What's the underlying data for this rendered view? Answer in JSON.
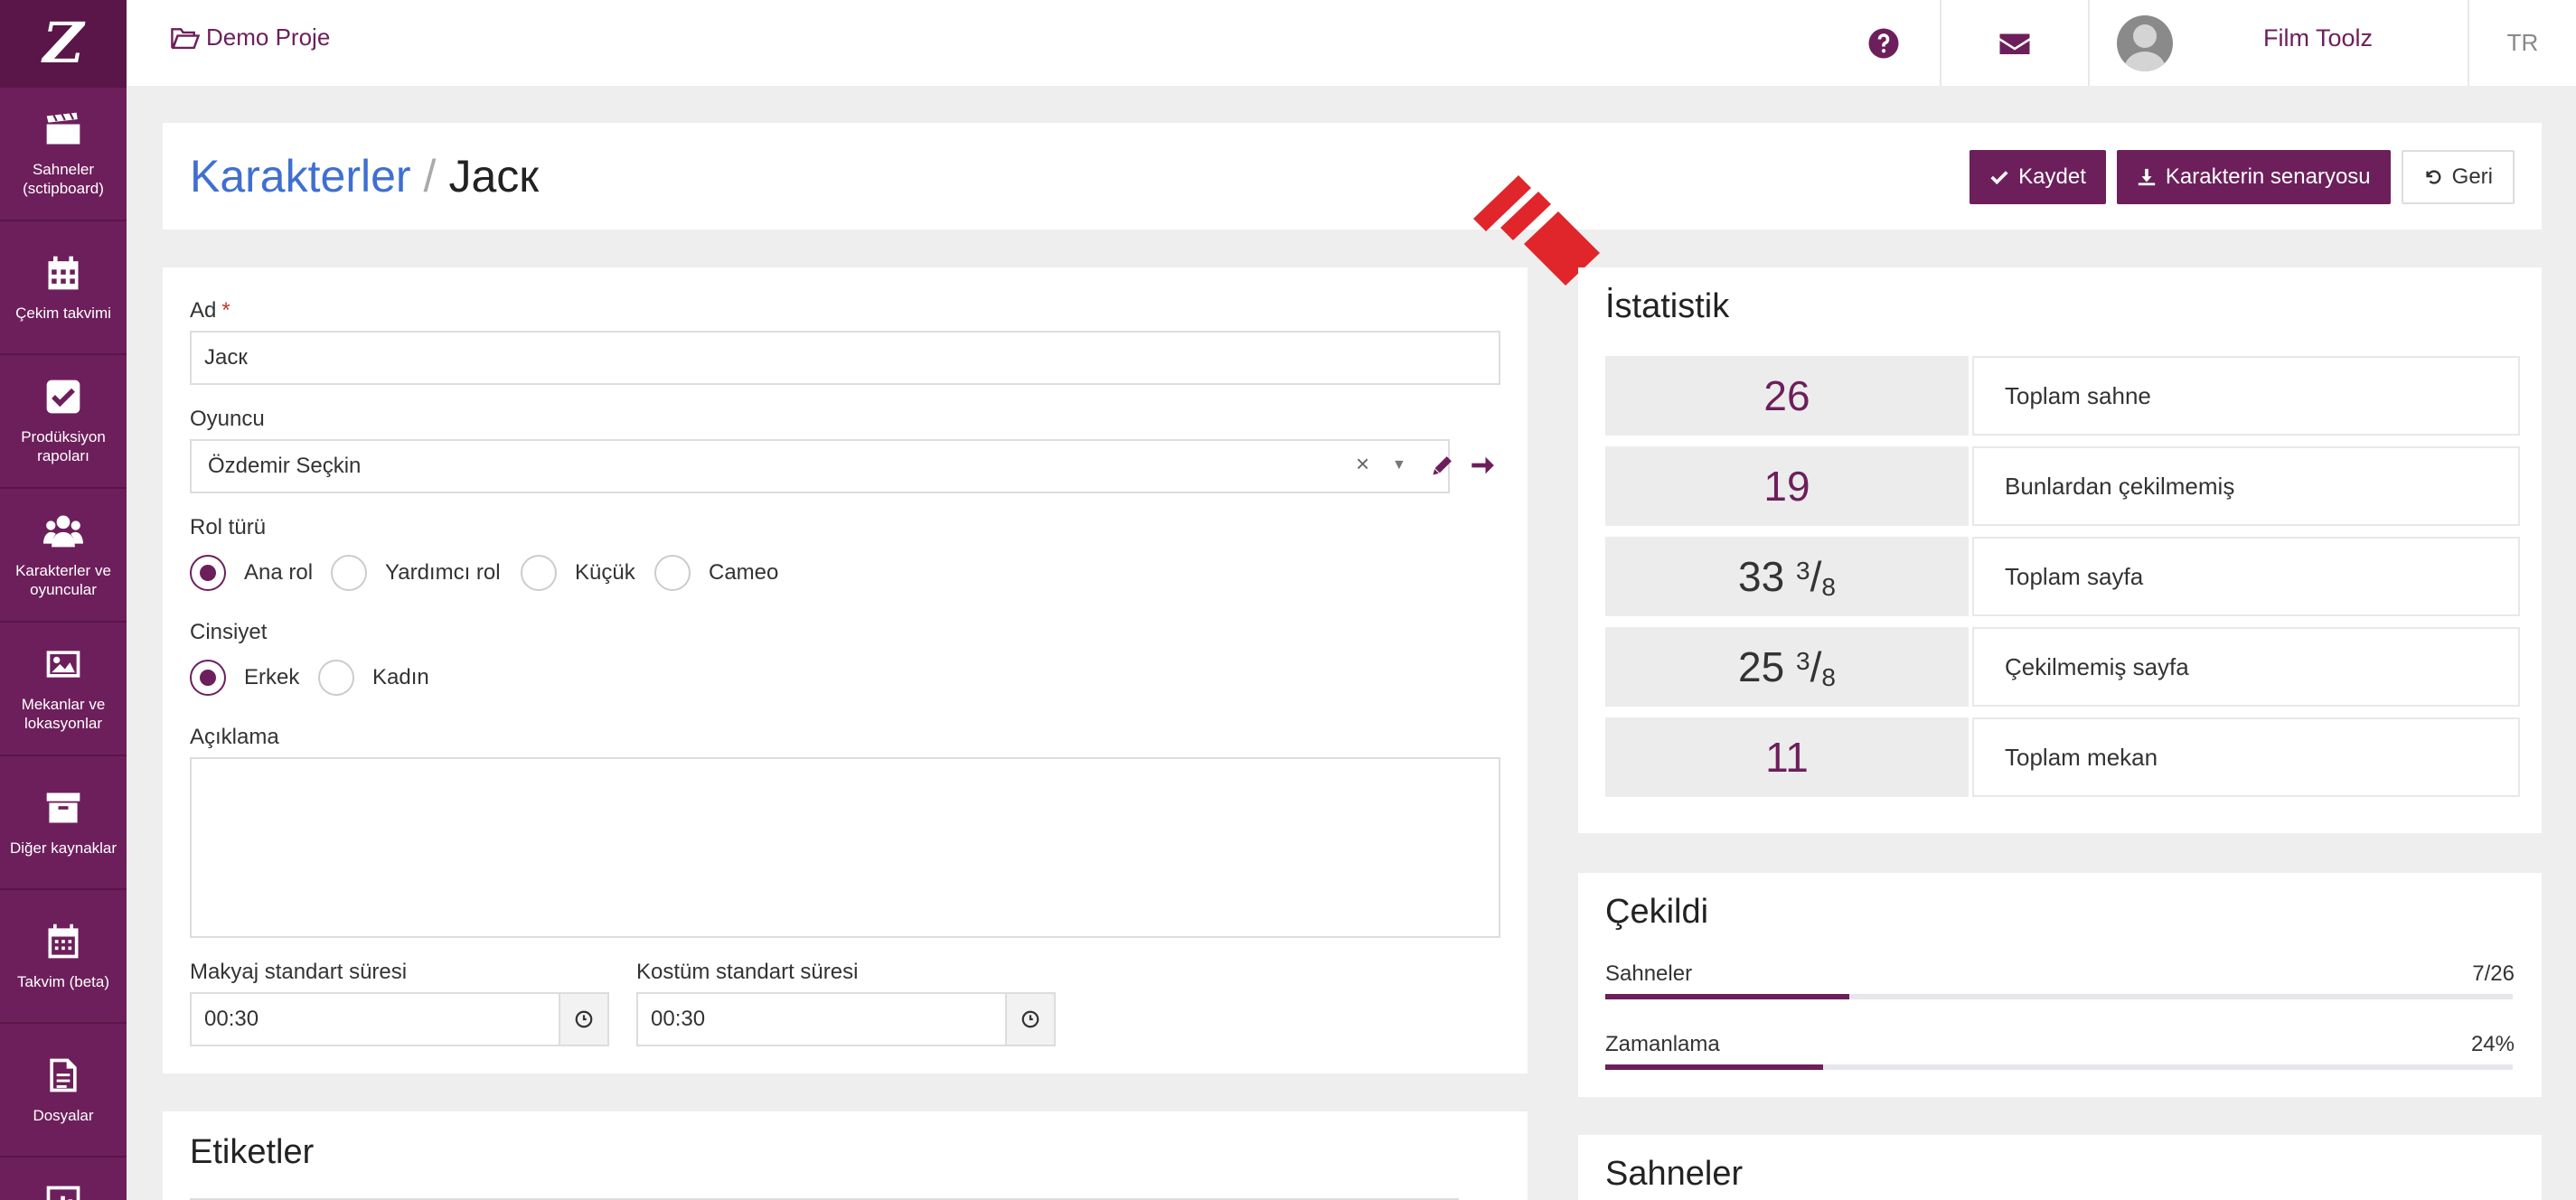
{
  "sidebar": {
    "logo": "Z",
    "items": [
      {
        "label": "Sahneler (sctipboard)",
        "icon": "clapperboard-icon"
      },
      {
        "label": "Çekim takvimi",
        "icon": "calendar-icon"
      },
      {
        "label": "Prodüksiyon rapoları",
        "icon": "check-square-icon"
      },
      {
        "label": "Karakterler ve oyuncular",
        "icon": "users-icon"
      },
      {
        "label": "Mekanlar ve lokasyonlar",
        "icon": "image-icon"
      },
      {
        "label": "Diğer kaynaklar",
        "icon": "archive-icon"
      },
      {
        "label": "Takvim (beta)",
        "icon": "calendar-grid-icon"
      },
      {
        "label": "Dosyalar",
        "icon": "file-icon"
      }
    ]
  },
  "topbar": {
    "project": "Demo Proje",
    "user_name": "Film Toolz",
    "lang": "TR"
  },
  "header": {
    "breadcrumb_link": "Karakterler",
    "separator": "/",
    "current": "Jacк",
    "save": "Kaydet",
    "script": "Karakterin senaryosu",
    "back": "Geri"
  },
  "form": {
    "name_label": "Ad",
    "name_required": "*",
    "name_value": "Jacк",
    "actor_label": "Oyuncu",
    "actor_value": "Özdemir Seçkin",
    "actor_clear": "×",
    "actor_caret": "▼",
    "role_label": "Rol türü",
    "roles": [
      {
        "label": "Ana rol",
        "checked": true
      },
      {
        "label": "Yardımcı rol",
        "checked": false
      },
      {
        "label": "Küçük",
        "checked": false
      },
      {
        "label": "Cameo",
        "checked": false
      }
    ],
    "gender_label": "Cinsiyet",
    "genders": [
      {
        "label": "Erkek",
        "checked": true
      },
      {
        "label": "Kadın",
        "checked": false
      }
    ],
    "desc_label": "Açıklama",
    "desc_value": "",
    "makeup_label": "Makyaj standart süresi",
    "makeup_value": "00:30",
    "costume_label": "Kostüm standart süresi",
    "costume_value": "00:30"
  },
  "tags": {
    "title": "Etiketler"
  },
  "stats": {
    "title": "İstatistik",
    "rows": [
      {
        "value": "26",
        "label": "Toplam sahne"
      },
      {
        "value": "19",
        "label": "Bunlardan çekilmemiş"
      },
      {
        "whole": "33",
        "num": "3",
        "slash": "/",
        "den": "8",
        "label": "Toplam sayfa"
      },
      {
        "whole": "25",
        "num": "3",
        "slash": "/",
        "den": "8",
        "label": "Çekilmemiş sayfa"
      },
      {
        "value": "11",
        "label": "Toplam mekan"
      }
    ]
  },
  "shot": {
    "title": "Çekildi",
    "scenes_label": "Sahneler",
    "scenes_value": "7/26",
    "scenes_fraction": 0.269,
    "schedule_label": "Zamanlama",
    "schedule_value": "24%",
    "schedule_fraction": 0.24
  },
  "scenes": {
    "title": "Sahneler"
  },
  "colors": {
    "brand": "#6d1f5b",
    "link": "#3f6fd1",
    "pointer": "#e0262b"
  }
}
